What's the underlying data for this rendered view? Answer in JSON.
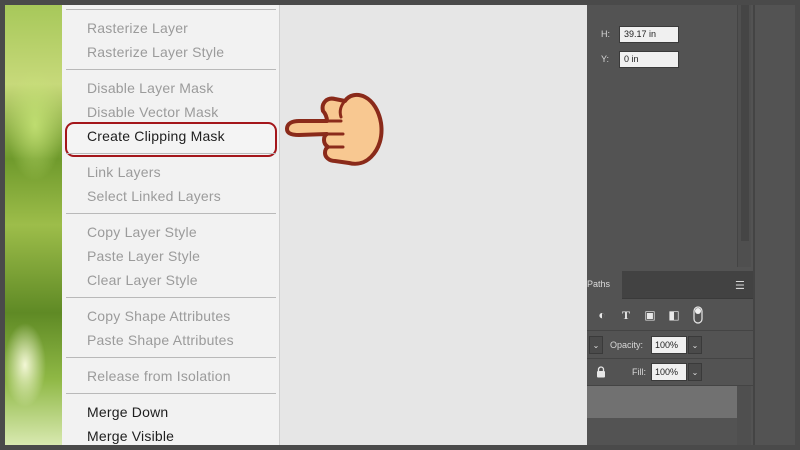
{
  "menu": {
    "items": [
      {
        "label": "Rasterize Layer",
        "enabled": false
      },
      {
        "label": "Rasterize Layer Style",
        "enabled": false
      },
      {
        "label": "Disable Layer Mask",
        "enabled": false
      },
      {
        "label": "Disable Vector Mask",
        "enabled": false
      },
      {
        "label": "Create Clipping Mask",
        "enabled": true,
        "highlighted": true
      },
      {
        "label": "Link Layers",
        "enabled": false
      },
      {
        "label": "Select Linked Layers",
        "enabled": false
      },
      {
        "label": "Copy Layer Style",
        "enabled": false
      },
      {
        "label": "Paste Layer Style",
        "enabled": false
      },
      {
        "label": "Clear Layer Style",
        "enabled": false
      },
      {
        "label": "Copy Shape Attributes",
        "enabled": false
      },
      {
        "label": "Paste Shape Attributes",
        "enabled": false
      },
      {
        "label": "Release from Isolation",
        "enabled": false
      },
      {
        "label": "Merge Down",
        "enabled": true
      },
      {
        "label": "Merge Visible",
        "enabled": true
      }
    ]
  },
  "properties": {
    "h_label": "H:",
    "h_value": "39.17 in",
    "y_label": "Y:",
    "y_value": "0 in"
  },
  "layers_panel": {
    "tab_paths": "Paths",
    "opacity_label": "Opacity:",
    "opacity_value": "100%",
    "fill_label": "Fill:",
    "fill_value": "100%"
  },
  "colors": {
    "highlight_border": "#a4161b",
    "hand_fill": "#f8c891",
    "hand_outline": "#8a2a1a"
  },
  "icons": {
    "pointer": "pointing-hand-icon",
    "lock": "lock-icon",
    "panel_menu": "hamburger-menu-icon"
  }
}
